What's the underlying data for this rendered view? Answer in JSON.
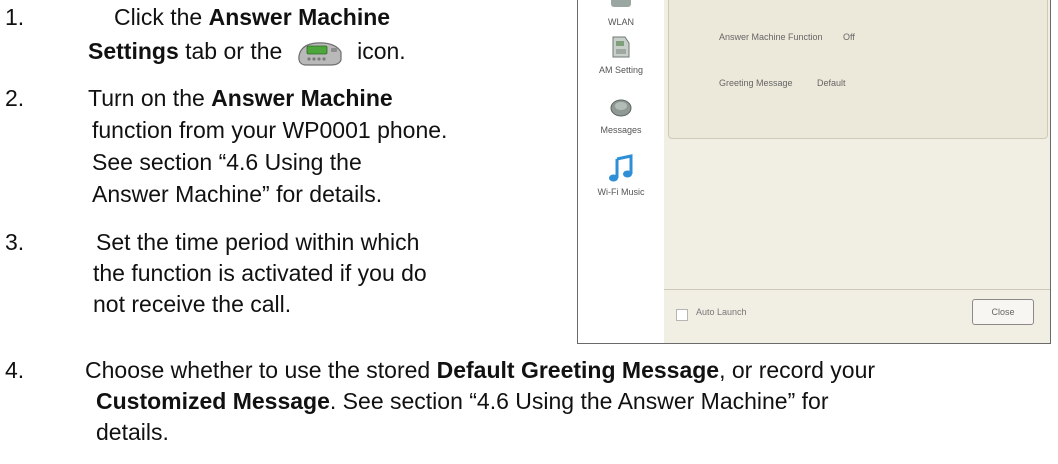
{
  "steps": [
    {
      "num": "1.",
      "pre": "Click the ",
      "b1": "Answer Machine",
      "b2": "Settings",
      "post": " tab or the ",
      "after_icon": " icon."
    },
    {
      "num": "2.",
      "pre": "Turn on the ",
      "b1": "Answer Machine",
      "l2": "function from your WP0001 phone.",
      "l3": "See section “4.6 Using the",
      "l4": "Answer Machine” for details."
    },
    {
      "num": "3.",
      "l1": "Set the time period within which",
      "l2": "the function is activated if you do",
      "l3": "not receive the call."
    },
    {
      "num": "4.",
      "pre": "Choose whether to use the stored ",
      "b1": "Default Greeting Message",
      "mid": ", or record your",
      "b2": "Customized Message",
      "post": ". See section “4.6 Using the Answer Machine” for",
      "l3": "details."
    }
  ],
  "icons": {
    "inline": "answer-machine-device-icon"
  },
  "screenshot": {
    "sidebar": [
      {
        "label": "WLAN",
        "icon": "wlan-icon"
      },
      {
        "label": "AM Setting",
        "icon": "answer-machine-icon"
      },
      {
        "label": "Messages",
        "icon": "messages-icon"
      },
      {
        "label": "Wi-Fi Music",
        "icon": "music-note-icon"
      }
    ],
    "fields": [
      {
        "label": "Answer Machine Function",
        "value": "Off"
      },
      {
        "label": "Greeting Message",
        "value": "Default"
      }
    ],
    "auto_launch": "Auto Launch",
    "close_label": "Close"
  },
  "colors": {
    "panel_bg": "#f1eee3",
    "sidebar_bg": "#ffffff",
    "music_icon": "#2f8fd6"
  }
}
